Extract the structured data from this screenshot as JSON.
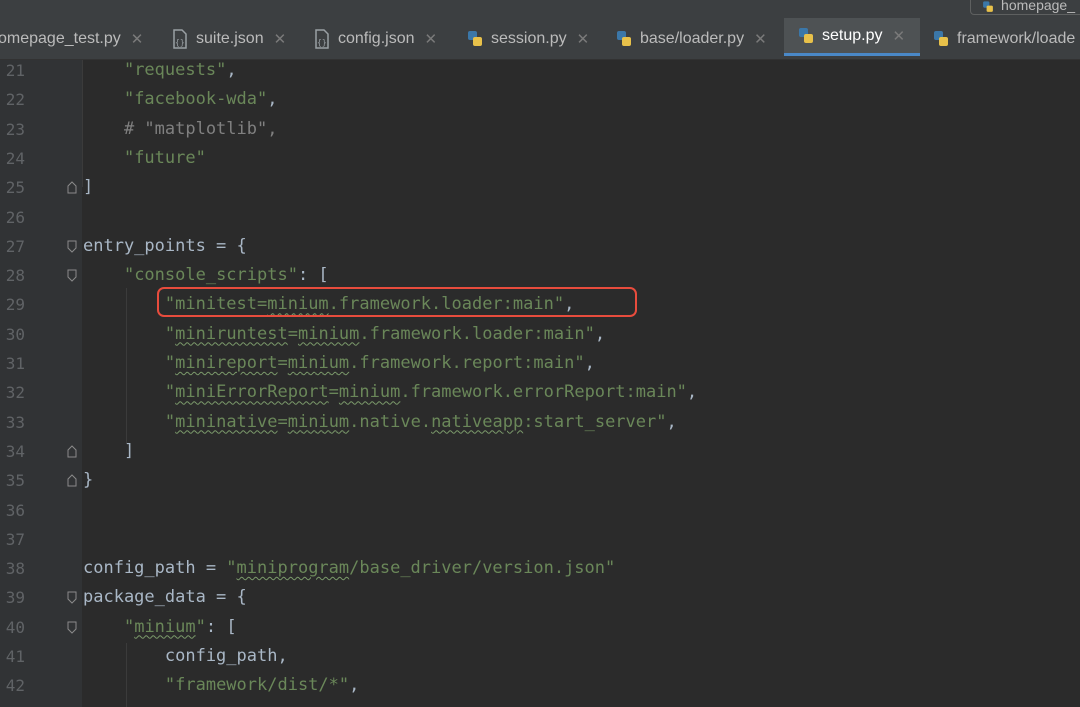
{
  "window": {
    "top_file_label": "homepage_"
  },
  "tabs": [
    {
      "label": "omepage_test.py",
      "icon": "python-file-icon",
      "active": false
    },
    {
      "label": "suite.json",
      "icon": "json-file-icon",
      "active": false
    },
    {
      "label": "config.json",
      "icon": "json-file-icon",
      "active": false
    },
    {
      "label": "session.py",
      "icon": "python-file-icon",
      "active": false
    },
    {
      "label": "base/loader.py",
      "icon": "python-file-icon",
      "active": false
    },
    {
      "label": "setup.py",
      "icon": "python-file-icon",
      "active": true
    },
    {
      "label": "framework/loade",
      "icon": "python-file-icon",
      "active": false
    }
  ],
  "colors": {
    "editor_background": "#2b2b2b",
    "string": "#6a8759",
    "comment": "#808080",
    "default_text": "#a9b7c6",
    "active_tab_underline": "#4a88c7",
    "highlight_box": "#e84c3d"
  },
  "editor": {
    "lines": [
      {
        "num": "21",
        "text": "    \"requests\","
      },
      {
        "num": "22",
        "text": "    \"facebook-wda\","
      },
      {
        "num": "23",
        "text": "    # \"matplotlib\","
      },
      {
        "num": "24",
        "text": "    \"future\""
      },
      {
        "num": "25",
        "text": "]"
      },
      {
        "num": "26",
        "text": ""
      },
      {
        "num": "27",
        "text": "entry_points = {"
      },
      {
        "num": "28",
        "text": "    \"console_scripts\": ["
      },
      {
        "num": "29",
        "text": "        \"minitest=minium.framework.loader:main\","
      },
      {
        "num": "30",
        "text": "        \"miniruntest=minium.framework.loader:main\","
      },
      {
        "num": "31",
        "text": "        \"minireport=minium.framework.report:main\","
      },
      {
        "num": "32",
        "text": "        \"miniErrorReport=minium.framework.errorReport:main\","
      },
      {
        "num": "33",
        "text": "        \"mininative=minium.native.nativeapp:start_server\","
      },
      {
        "num": "34",
        "text": "    ]"
      },
      {
        "num": "35",
        "text": "}"
      },
      {
        "num": "36",
        "text": ""
      },
      {
        "num": "37",
        "text": ""
      },
      {
        "num": "38",
        "text": "config_path = \"miniprogram/base_driver/version.json\""
      },
      {
        "num": "39",
        "text": "package_data = {"
      },
      {
        "num": "40",
        "text": "    \"minium\": ["
      },
      {
        "num": "41",
        "text": "        config_path,"
      },
      {
        "num": "42",
        "text": "        \"framework/dist/*\","
      }
    ],
    "highlighted_line": "29"
  }
}
